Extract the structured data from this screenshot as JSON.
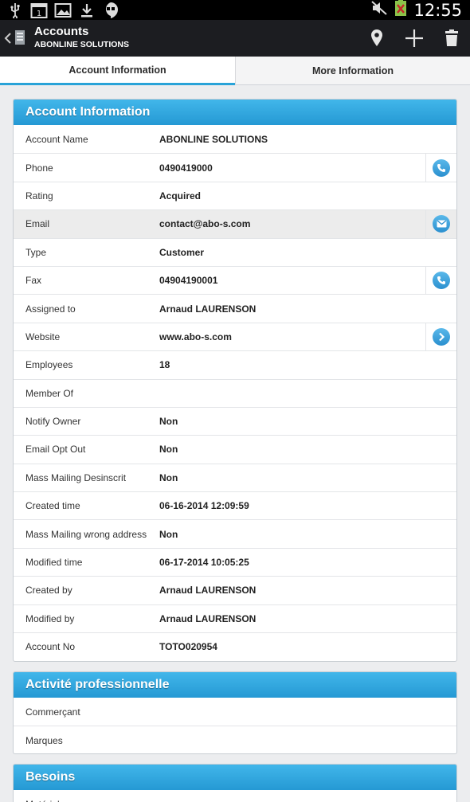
{
  "status_bar": {
    "time": "12:55",
    "left_icons": [
      "usb-icon",
      "calendar-icon",
      "gallery-icon",
      "download-icon",
      "hangouts-icon"
    ],
    "calendar_day": "1"
  },
  "action_bar": {
    "title": "Accounts",
    "subtitle": "ABONLINE SOLUTIONS",
    "actions": [
      "location-icon",
      "add-icon",
      "delete-icon"
    ]
  },
  "tabs": [
    {
      "label": "Account Information",
      "active": true
    },
    {
      "label": "More Information",
      "active": false
    }
  ],
  "sections": {
    "account_information": {
      "title": "Account Information",
      "fields": [
        {
          "label": "Account Name",
          "value": "ABONLINE SOLUTIONS"
        },
        {
          "label": "Phone",
          "value": "0490419000",
          "action": "phone-icon"
        },
        {
          "label": "Rating",
          "value": "Acquired"
        },
        {
          "label": "Email",
          "value": "contact@abo-s.com",
          "action": "email-icon"
        },
        {
          "label": "Type",
          "value": "Customer"
        },
        {
          "label": "Fax",
          "value": "04904190001",
          "action": "phone-icon"
        },
        {
          "label": "Assigned to",
          "value": "Arnaud LAURENSON"
        },
        {
          "label": "Website",
          "value": "www.abo-s.com",
          "action": "arrow-right-icon"
        },
        {
          "label": "Employees",
          "value": "18"
        },
        {
          "label": "Member Of",
          "value": ""
        },
        {
          "label": "Notify Owner",
          "value": "Non"
        },
        {
          "label": "Email Opt Out",
          "value": "Non"
        },
        {
          "label": "Mass Mailing Desinscrit",
          "value": "Non"
        },
        {
          "label": "Created time",
          "value": "06-16-2014 12:09:59"
        },
        {
          "label": "Mass Mailing wrong address",
          "value": "Non"
        },
        {
          "label": "Modified time",
          "value": "06-17-2014 10:05:25"
        },
        {
          "label": "Created by",
          "value": "Arnaud LAURENSON"
        },
        {
          "label": "Modified by",
          "value": "Arnaud LAURENSON"
        },
        {
          "label": "Account No",
          "value": "TOTO020954"
        }
      ]
    },
    "activite": {
      "title": "Activité professionnelle",
      "fields": [
        {
          "label": "Commerçant",
          "value": ""
        },
        {
          "label": "Marques",
          "value": ""
        }
      ]
    },
    "besoins": {
      "title": "Besoins",
      "fields": [
        {
          "label": "Matériel",
          "value": ""
        }
      ]
    }
  },
  "colors": {
    "accent": "#29a3d8",
    "header_start": "#41b6ea",
    "header_end": "#2599d4",
    "action_bar": "#1c1d21"
  }
}
